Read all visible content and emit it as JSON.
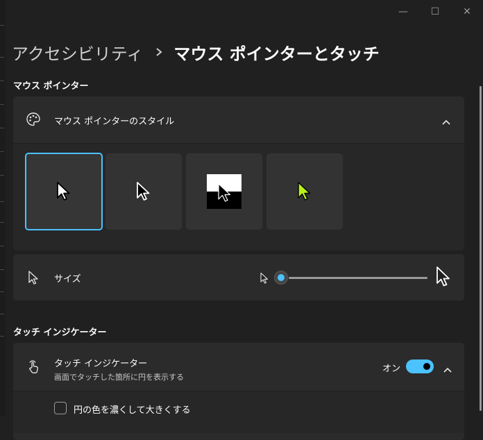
{
  "window": {
    "controls": {
      "minimize": "—",
      "maximize": "☐",
      "close": "✕"
    }
  },
  "breadcrumb": {
    "parent": "アクセシビリティ",
    "current": "マウス ポインターとタッチ"
  },
  "mouse_section": {
    "title": "マウス ポインター",
    "style_card": {
      "label": "マウス ポインターのスタイル",
      "icon": "palette-icon",
      "expanded": true,
      "options": [
        {
          "name": "white",
          "selected": true
        },
        {
          "name": "black",
          "selected": false
        },
        {
          "name": "inverted",
          "selected": false
        },
        {
          "name": "custom",
          "color": "#b6f01a",
          "selected": false
        }
      ]
    },
    "size_card": {
      "label": "サイズ",
      "icon": "cursor-icon",
      "slider_value": 1,
      "slider_min": 1,
      "slider_max": 15
    }
  },
  "touch_section": {
    "title": "タッチ インジケーター",
    "indicator_card": {
      "label": "タッチ インジケーター",
      "description": "画面でタッチした箇所に円を表示する",
      "icon": "touch-icon",
      "toggle_label": "オン",
      "toggle_on": true
    },
    "option": {
      "label": "円の色を濃くして大きくする",
      "checked": false
    }
  },
  "colors": {
    "accent": "#4cc2ff",
    "custom_pointer": "#b6f01a",
    "background": "#202020",
    "card": "#2b2b2b"
  }
}
